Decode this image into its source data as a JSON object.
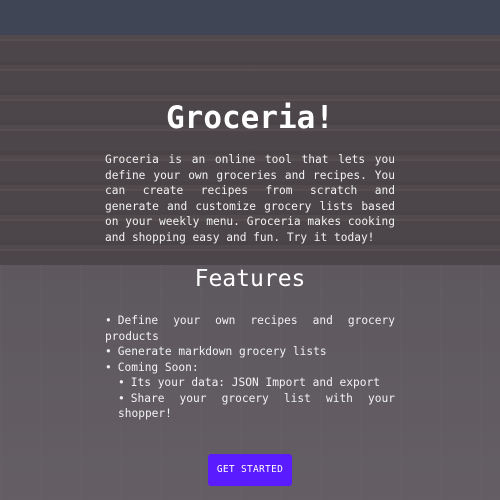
{
  "hero": {
    "title": "Groceria!",
    "intro": "Groceria is an online tool that lets you define your own groceries and recipes. You can create recipes from scratch and generate and customize grocery lists based on your weekly menu. Groceria makes cooking and shopping easy and fun. Try it today!"
  },
  "features": {
    "heading": "Features",
    "bullet": "•",
    "items": [
      "Define your own recipes and grocery products",
      "Generate markdown grocery lists",
      "Coming Soon:"
    ],
    "coming_soon": [
      "Its your data: JSON Import and export",
      "Share your grocery list with your shopper!"
    ]
  },
  "cta": {
    "label": "GET STARTED"
  },
  "colors": {
    "topbar": "#3f4555",
    "cta": "#5a1cff",
    "text": "#ffffff"
  }
}
